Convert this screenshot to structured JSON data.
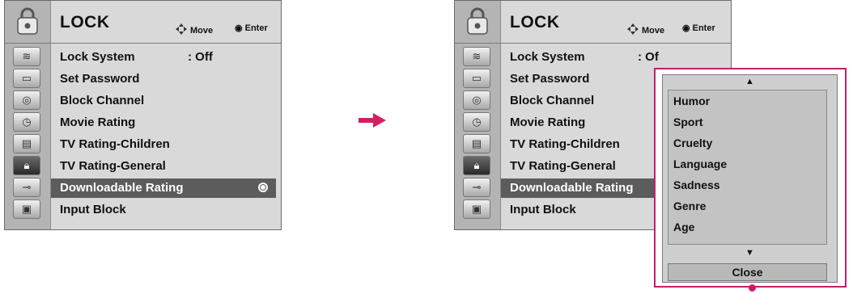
{
  "menu": {
    "title": "LOCK",
    "hint_move": "Move",
    "hint_enter": "Enter",
    "items": [
      {
        "label": "Lock System",
        "value": ": Off"
      },
      {
        "label": "Set Password"
      },
      {
        "label": "Block Channel"
      },
      {
        "label": "Movie Rating"
      },
      {
        "label": "TV Rating-Children"
      },
      {
        "label": "TV Rating-General"
      },
      {
        "label": "Downloadable Rating"
      },
      {
        "label": "Input Block"
      }
    ],
    "selected_index": 6,
    "right_value_truncated": ": Of"
  },
  "side_icons": [
    "wave-icon",
    "tv-screen-icon",
    "target-icon",
    "clock-icon",
    "film-icon",
    "lock-icon",
    "plug-icon",
    "picture-icon"
  ],
  "popup": {
    "options": [
      "Humor",
      "Sport",
      "Cruelty",
      "Language",
      "Sadness",
      "Genre",
      "Age"
    ],
    "close_label": "Close",
    "scroll_up": "▲",
    "scroll_down": "▼"
  },
  "colors": {
    "panel_bg": "#d9d9d9",
    "selected_bg": "#5c5c5c",
    "callout": "#c41e68",
    "arrow": "#d6205e"
  }
}
